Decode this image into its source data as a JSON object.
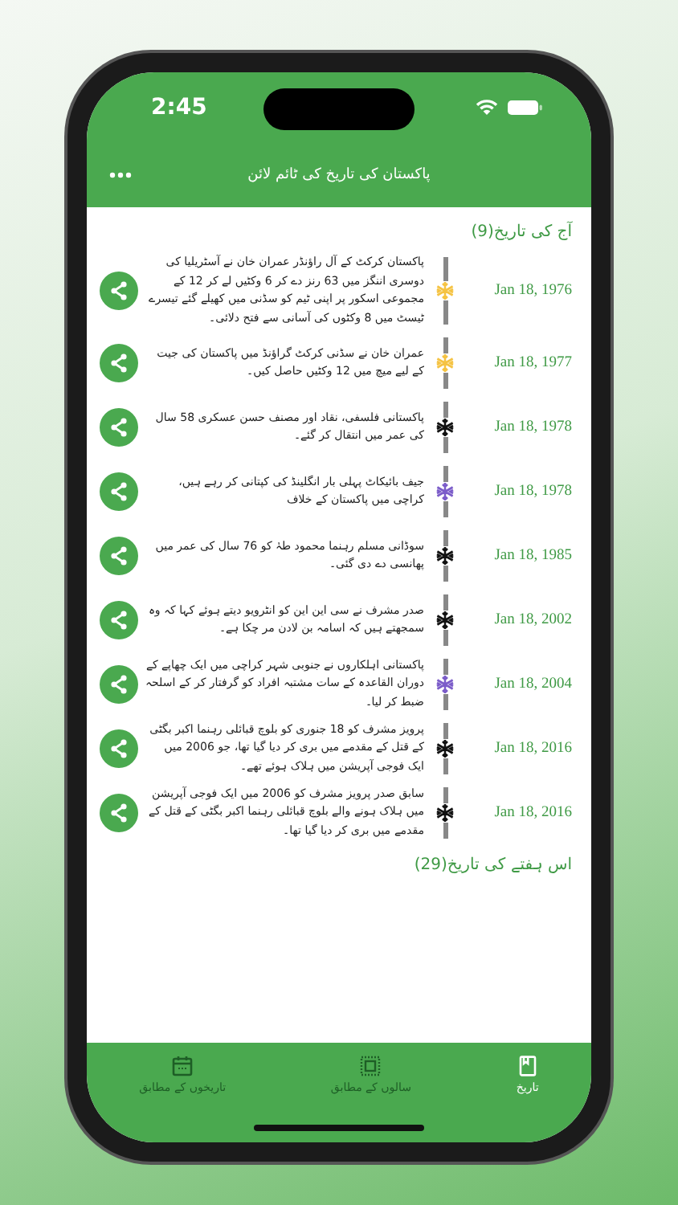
{
  "status_bar": {
    "time": "2:45"
  },
  "header": {
    "title": "پاکستان کی تاریخ کی ٹائم لائن"
  },
  "sections": [
    {
      "title": "آج کی تاریخ(9)",
      "events": [
        {
          "date": "Jan 18, 1976",
          "text": "پاکستان کرکٹ کے آل راؤنڈر عمران خان نے آسٹریلیا کی دوسری اننگز میں 63 رنز دے کر 6 وکٹیں لے کر 12 کے مجموعی اسکور پر اپنی ٹیم کو سڈنی میں کھیلے گئے تیسرے ٹیسٹ میں 8 وکٹوں کی آسانی سے فتح دلائی۔",
          "color": "#f5c343"
        },
        {
          "date": "Jan 18, 1977",
          "text": "عمران خان نے سڈنی کرکٹ گراؤنڈ میں پاکستان کی جیت کے لیے میچ میں 12 وکٹیں حاصل کیں۔",
          "color": "#f5c343"
        },
        {
          "date": "Jan 18, 1978",
          "text": "پاکستانی فلسفی، نقاد اور مصنف حسن عسکری 58 سال کی عمر میں انتقال کر گئے۔",
          "color": "#111111"
        },
        {
          "date": "Jan 18, 1978",
          "text": "جیف بائیکاٹ پہلی بار انگلینڈ کی کپتانی کر رہے ہیں، کراچی میں پاکستان کے خلاف",
          "color": "#7b5cc9"
        },
        {
          "date": "Jan 18, 1985",
          "text": "سوڈانی مسلم رہنما محمود طہٰ کو 76 سال کی عمر میں پھانسی دے دی گئی۔",
          "color": "#111111"
        },
        {
          "date": "Jan 18, 2002",
          "text": "صدر مشرف نے سی این این کو انٹرویو دیتے ہوئے کہا کہ وہ سمجھتے ہیں کہ اسامہ بن لادن مر چکا ہے۔",
          "color": "#111111"
        },
        {
          "date": "Jan 18, 2004",
          "text": "پاکستانی اہلکاروں نے جنوبی شہر کراچی میں ایک چھاپے کے دوران القاعدہ کے سات مشتبہ افراد کو گرفتار کر کے اسلحہ ضبط کر لیا۔",
          "color": "#7b5cc9"
        },
        {
          "date": "Jan 18, 2016",
          "text": "پرویز مشرف کو 18 جنوری کو بلوچ قبائلی رہنما اکبر بگٹی کے قتل کے مقدمے میں بری کر دیا گیا تھا، جو 2006 میں ایک فوجی آپریشن میں ہلاک ہوئے تھے۔",
          "color": "#111111"
        },
        {
          "date": "Jan 18, 2016",
          "text": "سابق صدر پرویز مشرف کو 2006 میں ایک فوجی آپریشن میں ہلاک ہونے والے بلوچ قبائلی رہنما اکبر بگٹی کے قتل کے مقدمے میں بری کر دیا گیا تھا۔",
          "color": "#111111"
        }
      ]
    },
    {
      "title": "اس ہفتے کی تاریخ(29)"
    }
  ],
  "tab_bar": [
    {
      "label": "تاریخ",
      "kind": "history",
      "selected": true
    },
    {
      "label": "سالوں کے مطابق",
      "kind": "years",
      "selected": false
    },
    {
      "label": "تاریخوں کے مطابق",
      "kind": "calendar",
      "selected": false
    }
  ]
}
